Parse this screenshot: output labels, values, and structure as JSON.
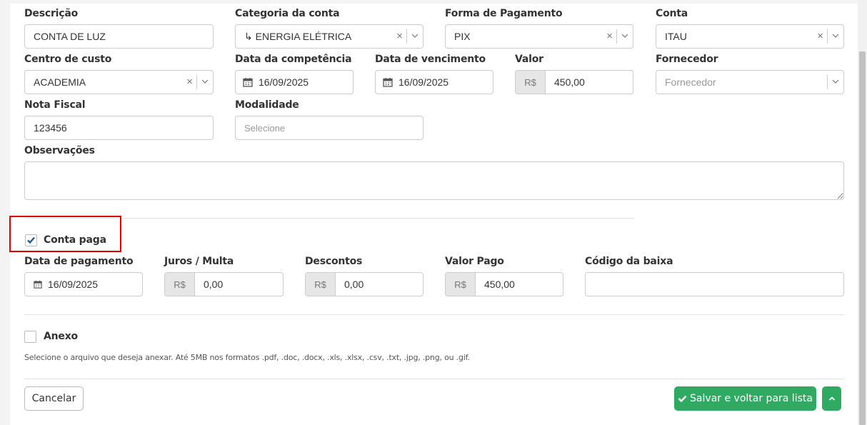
{
  "form": {
    "descricao": {
      "label": "Descrição",
      "value": "CONTA DE LUZ"
    },
    "categoria": {
      "label": "Categoria da conta",
      "value": "↳ ENERGIA ELÉTRICA"
    },
    "forma_pagamento": {
      "label": "Forma de Pagamento",
      "value": "PIX"
    },
    "conta": {
      "label": "Conta",
      "value": "ITAU"
    },
    "centro_custo": {
      "label": "Centro de custo",
      "value": "ACADEMIA"
    },
    "data_competencia": {
      "label": "Data da competência",
      "value": "16/09/2025"
    },
    "data_vencimento": {
      "label": "Data de vencimento",
      "value": "16/09/2025"
    },
    "valor": {
      "label": "Valor",
      "prefix": "R$",
      "value": "450,00"
    },
    "fornecedor": {
      "label": "Fornecedor",
      "placeholder": "Fornecedor"
    },
    "nota_fiscal": {
      "label": "Nota Fiscal",
      "value": "123456"
    },
    "modalidade": {
      "label": "Modalidade",
      "placeholder": "Selecione"
    },
    "observacoes": {
      "label": "Observações",
      "value": ""
    }
  },
  "payment": {
    "conta_paga": {
      "label": "Conta paga",
      "checked": true
    },
    "data_pagamento": {
      "label": "Data de pagamento",
      "value": "16/09/2025"
    },
    "juros_multa": {
      "label": "Juros / Multa",
      "prefix": "R$",
      "value": "0,00"
    },
    "descontos": {
      "label": "Descontos",
      "prefix": "R$",
      "value": "0,00"
    },
    "valor_pago": {
      "label": "Valor Pago",
      "prefix": "R$",
      "value": "450,00"
    },
    "codigo_baixa": {
      "label": "Código da baixa",
      "value": ""
    }
  },
  "anexo": {
    "label": "Anexo",
    "checked": false,
    "help": "Selecione o arquivo que deseja anexar. Até 5MB nos formatos .pdf, .doc, .docx, .xls, .xlsx, .csv, .txt, .jpg, .png, ou .gif."
  },
  "actions": {
    "cancel_label": "Cancelar",
    "save_label": "Salvar e voltar para lista"
  },
  "colors": {
    "save": "#2eaa63",
    "highlight": "#e00000",
    "check": "#1d5c8c"
  }
}
